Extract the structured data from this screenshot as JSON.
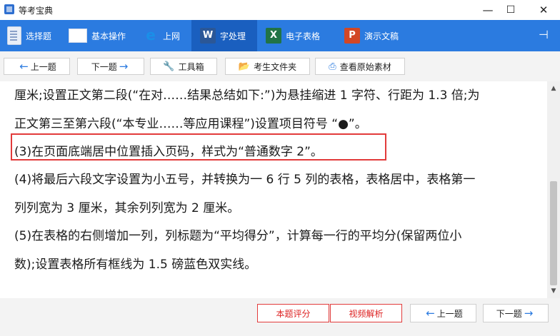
{
  "window": {
    "title": "等考宝典",
    "minimize": "—",
    "maximize": "☐",
    "close": "✕"
  },
  "menu": {
    "items": [
      {
        "label": "选择题",
        "icon": "document-icon"
      },
      {
        "label": "基本操作",
        "icon": "window-icon"
      },
      {
        "label": "上网",
        "icon": "ie-icon"
      },
      {
        "label": "字处理",
        "icon": "word-icon",
        "active": true
      },
      {
        "label": "电子表格",
        "icon": "excel-icon"
      },
      {
        "label": "演示文稿",
        "icon": "powerpoint-icon"
      }
    ],
    "pin": "⊣"
  },
  "toolbar": {
    "prev": "上一题",
    "next": "下一题",
    "toolbox": "工具箱",
    "student_folder": "考生文件夹",
    "view_source": "查看原始素材"
  },
  "content": {
    "lines": [
      "厘米;设置正文第二段(“在对……结果总结如下:”)为悬挂缩进 1 字符、行距为 1.3 倍;为",
      "正文第三至第六段(“本专业……等应用课程”)设置项目符号 “●”。",
      "(3)在页面底端居中位置插入页码，样式为“普通数字 2”。",
      "(4)将最后六段文字设置为小五号，并转换为一 6 行 5 列的表格，表格居中，表格第一",
      "列列宽为 3 厘米，其余列列宽为 2 厘米。",
      "(5)在表格的右侧增加一列，列标题为“平均得分”，计算每一行的平均分(保留两位小",
      "数);设置表格所有框线为 1.5 磅蓝色双实线。"
    ]
  },
  "bottom": {
    "score": "本题评分",
    "video": "视频解析",
    "prev": "上一题",
    "next": "下一题"
  },
  "colors": {
    "accent": "#2b7be0",
    "highlight": "#e23b3b"
  }
}
